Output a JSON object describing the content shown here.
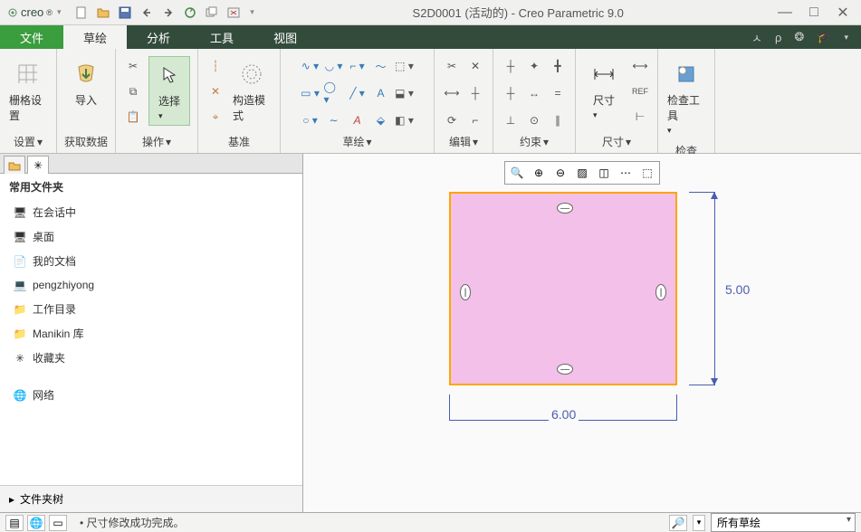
{
  "title": "S2D0001 (活动的) - Creo Parametric 9.0",
  "brand": "creo",
  "tabs": {
    "file": "文件",
    "sketch": "草绘",
    "analysis": "分析",
    "tools": "工具",
    "view": "视图"
  },
  "ribbon": {
    "grid": {
      "btn": "栅格设置",
      "label": "设置"
    },
    "import": {
      "btn": "导入",
      "label": "获取数据"
    },
    "select": {
      "btn": "选择",
      "label": "操作"
    },
    "datum": {
      "btn": "构造模式",
      "label": "基准"
    },
    "sketch_label": "草绘",
    "edit_label": "编辑",
    "constraint_label": "约束",
    "dimension": {
      "btn": "尺寸",
      "label": "尺寸"
    },
    "inspect": {
      "btn": "检查工具",
      "label": "检查"
    }
  },
  "sidepanel": {
    "header": "常用文件夹",
    "items": [
      {
        "label": "在会话中"
      },
      {
        "label": "桌面"
      },
      {
        "label": "我的文档"
      },
      {
        "label": "pengzhiyong"
      },
      {
        "label": "工作目录"
      },
      {
        "label": "Manikin 库"
      },
      {
        "label": "收藏夹"
      },
      {
        "label": "网络"
      }
    ],
    "tree": "文件夹树"
  },
  "dimensions": {
    "width": "6.00",
    "height": "5.00"
  },
  "status": {
    "message": "尺寸修改成功完成。",
    "filter": "所有草绘"
  }
}
